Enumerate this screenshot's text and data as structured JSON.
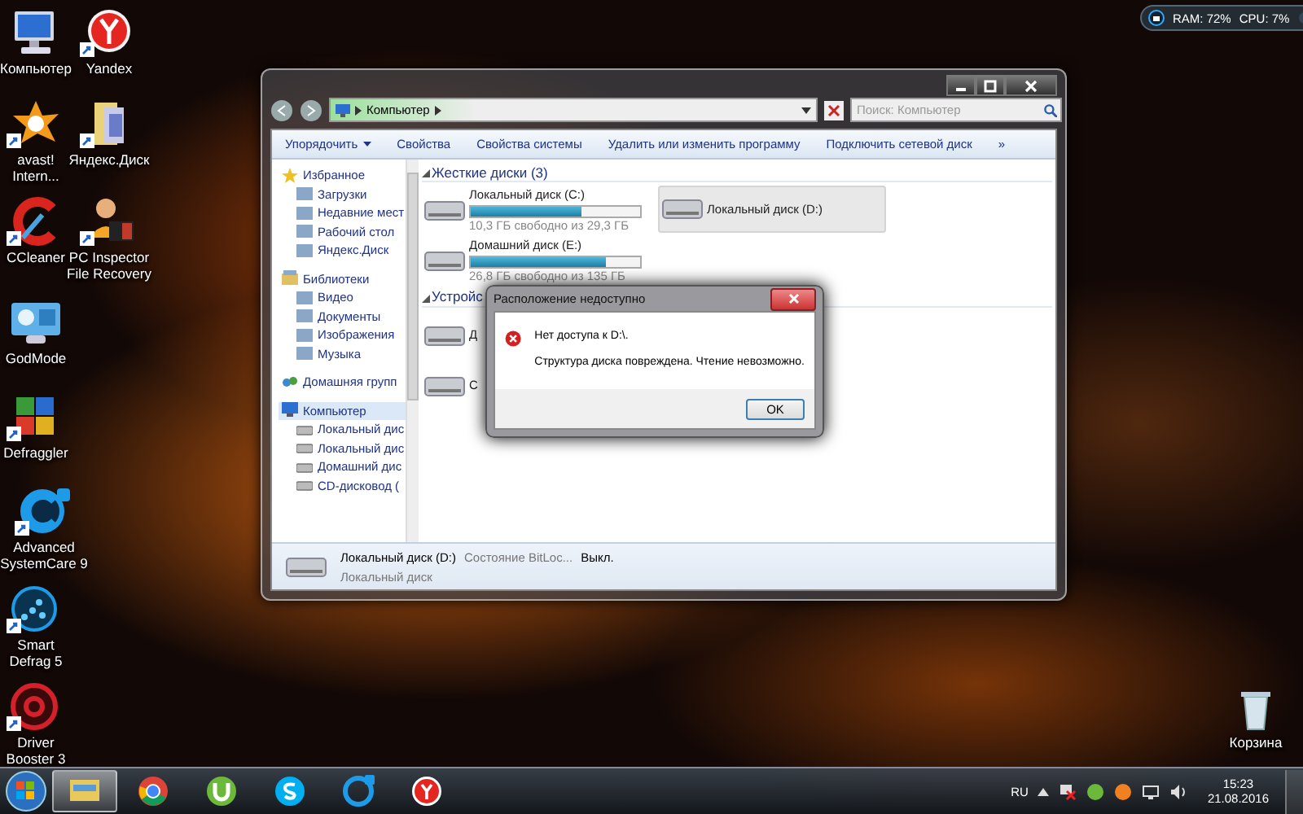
{
  "desktop": {
    "icons": [
      {
        "label": "Компьютер"
      },
      {
        "label": "Yandex"
      },
      {
        "label": "avast! Intern..."
      },
      {
        "label": "Яндекс.Диск"
      },
      {
        "label": "CCleaner"
      },
      {
        "label": "PC Inspector File Recovery"
      },
      {
        "label": "GodMode"
      },
      {
        "label": "Defraggler"
      },
      {
        "label": "Advanced SystemCare 9"
      },
      {
        "label": "Smart Defrag 5"
      },
      {
        "label": "Driver Booster 3"
      }
    ],
    "recycle_bin": {
      "label": "Корзина"
    }
  },
  "gadget": {
    "ram": "RAM: 72%",
    "cpu": "CPU: 7%"
  },
  "explorer": {
    "address": {
      "crumbs": [
        "Компьютер"
      ]
    },
    "search": {
      "placeholder": "Поиск: Компьютер"
    },
    "toolbar": [
      {
        "label": "Упорядочить",
        "dropdown": true
      },
      {
        "label": "Свойства",
        "dropdown": false
      },
      {
        "label": "Свойства системы",
        "dropdown": false
      },
      {
        "label": "Удалить или изменить программу",
        "dropdown": false
      },
      {
        "label": "Подключить сетевой диск",
        "dropdown": false
      }
    ],
    "overflow": "»",
    "sidebar": [
      {
        "label": "Избранное",
        "selected": false,
        "children": [
          {
            "label": "Загрузки",
            "selected": false
          },
          {
            "label": "Недавние мест",
            "selected": false
          },
          {
            "label": "Рабочий стол",
            "selected": false
          },
          {
            "label": "Яндекс.Диск",
            "selected": false
          }
        ]
      },
      {
        "label": "Библиотеки",
        "selected": false,
        "children": [
          {
            "label": "Видео",
            "selected": false
          },
          {
            "label": "Документы",
            "selected": false
          },
          {
            "label": "Изображения",
            "selected": false
          },
          {
            "label": "Музыка",
            "selected": false
          }
        ]
      },
      {
        "label": "Домашняя групп",
        "selected": false
      },
      {
        "label": "Компьютер",
        "selected": true,
        "children": [
          {
            "label": "Локальный дис",
            "selected": false
          },
          {
            "label": "Локальный дис",
            "selected": false
          },
          {
            "label": "Домашний дис",
            "selected": false
          },
          {
            "label": "CD-дисковод (",
            "selected": false
          }
        ]
      }
    ],
    "sections": [
      {
        "title": "Жесткие диски (3)",
        "drives": [
          {
            "name": "Локальный диск (C:)",
            "level": 0.65,
            "free": "10,3 ГБ свободно из 29,3 ГБ",
            "selected": false
          },
          {
            "name": "Домашний диск (E:)",
            "level": 0.8,
            "free": "26,8 ГБ свободно из 135 ГБ",
            "selected": false
          },
          {
            "name": "Локальный диск (D:)",
            "selected": true
          }
        ]
      },
      {
        "title": "Устройс",
        "drives": [
          {
            "name": "Д",
            "selected": false
          },
          {
            "name": "С",
            "selected": false
          }
        ]
      }
    ],
    "details": {
      "name": "Локальный диск (D:)",
      "property": "Состояние BitLoc...",
      "value": "Выкл.",
      "type": "Локальный диск"
    }
  },
  "dialog": {
    "title": "Расположение недоступно",
    "message": "Нет доступа к D:\\.",
    "detail": "Структура диска повреждена. Чтение невозможно.",
    "button": "OK"
  },
  "taskbar": {
    "language": "RU",
    "time": "15:23",
    "date": "21.08.2016",
    "apps": [
      {
        "selected": true
      },
      {
        "selected": false
      },
      {
        "selected": false
      },
      {
        "selected": false
      },
      {
        "selected": false
      },
      {
        "selected": false
      }
    ]
  }
}
